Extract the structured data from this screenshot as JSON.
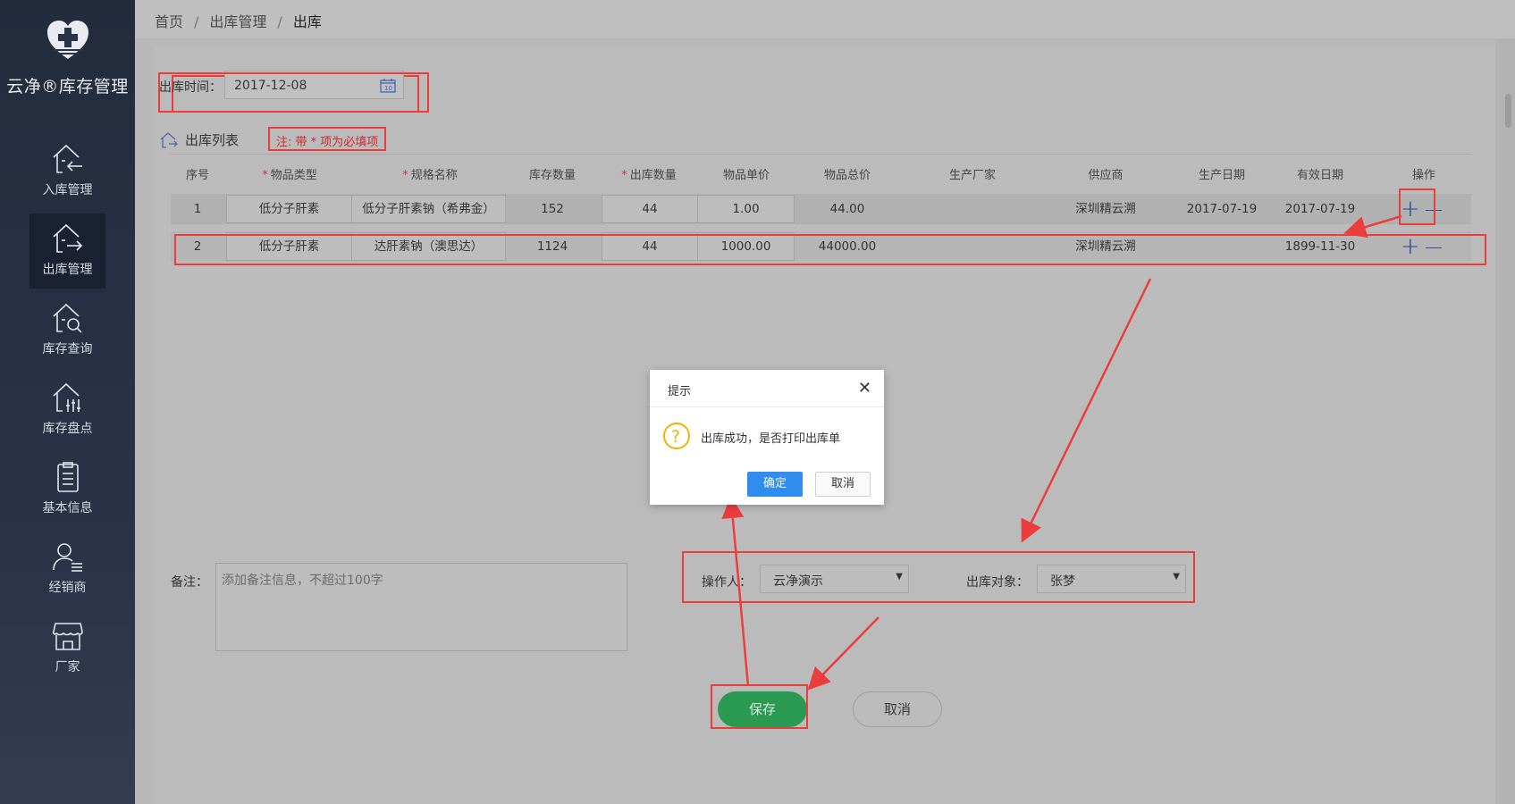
{
  "app": {
    "title": "云净®库存管理"
  },
  "colors": {
    "sidebar_bg": "#2b3447",
    "save_green": "#2a9a52",
    "dialog_ok_blue": "#2e8ded",
    "annotation_red": "#ec3d3d",
    "link_blue": "#20408f"
  },
  "sidebar": {
    "items": [
      {
        "label": "入库管理",
        "icon": "warehouse-in-icon"
      },
      {
        "label": "出库管理",
        "icon": "warehouse-out-icon",
        "active": true
      },
      {
        "label": "库存查询",
        "icon": "warehouse-search-icon"
      },
      {
        "label": "库存盘点",
        "icon": "warehouse-count-icon"
      },
      {
        "label": "基本信息",
        "icon": "clipboard-icon"
      },
      {
        "label": "经销商",
        "icon": "dealer-icon"
      },
      {
        "label": "厂家",
        "icon": "store-icon"
      }
    ]
  },
  "breadcrumb": {
    "items": [
      "首页",
      "出库管理",
      "出库"
    ],
    "sep": "/"
  },
  "form": {
    "date_label": "出库时间：",
    "date_value": "2017-12-08",
    "list_title": "出库列表",
    "note": "注: 带 * 项为必填项",
    "required_mark": "*"
  },
  "table": {
    "headers": [
      "序号",
      "物品类型",
      "规格名称",
      "库存数量",
      "出库数量",
      "物品单价",
      "物品总价",
      "生产厂家",
      "供应商",
      "生产日期",
      "有效日期",
      "操作"
    ],
    "rows": [
      {
        "no": "1",
        "type": "低分子肝素",
        "spec": "低分子肝素钠（希弗金）",
        "stock": "152",
        "out_qty": "44",
        "unit_price": "1.00",
        "total": "44.00",
        "maker": "",
        "supplier": "深圳精云溯",
        "prod_date": "2017-07-19",
        "expire": "2017-07-19"
      },
      {
        "no": "2",
        "type": "低分子肝素",
        "spec": "达肝素钠（澳思达）",
        "stock": "1124",
        "out_qty": "44",
        "unit_price": "1000.00",
        "total": "44000.00",
        "maker": "",
        "supplier": "深圳精云溯",
        "prod_date": "",
        "expire": "1899-11-30"
      }
    ],
    "add_symbol": "+",
    "remove_symbol": "—"
  },
  "remark": {
    "label": "备注：",
    "placeholder": "添加备注信息，不超过100字"
  },
  "operator": {
    "label": "操作人：",
    "value": "云净演示"
  },
  "target": {
    "label": "出库对象：",
    "value": "张梦"
  },
  "actions": {
    "save": "保存",
    "cancel": "取消"
  },
  "dialog": {
    "title": "提示",
    "message": "出库成功，是否打印出库单",
    "ok": "确定",
    "cancel": "取消"
  }
}
